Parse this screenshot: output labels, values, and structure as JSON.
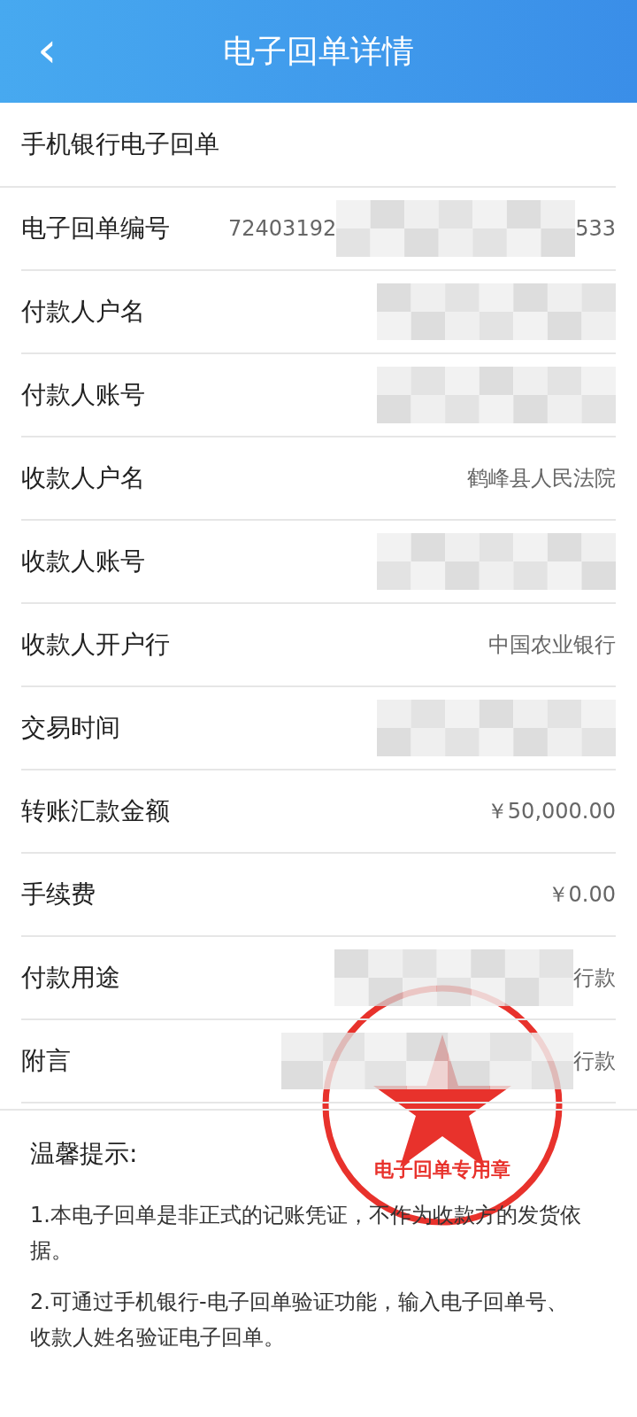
{
  "header": {
    "back_icon": "‹",
    "title": "电子回单详情"
  },
  "section_title": "手机银行电子回单",
  "rows": [
    {
      "label": "电子回单编号",
      "parts": [
        {
          "kind": "text",
          "text": "72403192"
        },
        {
          "kind": "redacted"
        },
        {
          "kind": "text",
          "text": "533"
        }
      ]
    },
    {
      "label": "付款人户名",
      "parts": [
        {
          "kind": "redacted"
        }
      ]
    },
    {
      "label": "付款人账号",
      "parts": [
        {
          "kind": "redacted"
        }
      ]
    },
    {
      "label": "收款人户名",
      "parts": [
        {
          "kind": "text",
          "text": "鹤峰县人民法院"
        }
      ]
    },
    {
      "label": "收款人账号",
      "parts": [
        {
          "kind": "redacted"
        }
      ]
    },
    {
      "label": "收款人开户行",
      "parts": [
        {
          "kind": "text",
          "text": "中国农业银行"
        }
      ]
    },
    {
      "label": "交易时间",
      "parts": [
        {
          "kind": "redacted"
        }
      ]
    },
    {
      "label": "转账汇款金额",
      "parts": [
        {
          "kind": "text",
          "text": "￥50,000.00"
        }
      ]
    },
    {
      "label": "手续费",
      "parts": [
        {
          "kind": "text",
          "text": "￥0.00"
        }
      ]
    },
    {
      "label": "付款用途",
      "parts": [
        {
          "kind": "redacted"
        },
        {
          "kind": "text",
          "text": "行款"
        }
      ]
    },
    {
      "label": "附言",
      "parts": [
        {
          "kind": "redacted"
        },
        {
          "kind": "text",
          "text": "行款"
        }
      ]
    }
  ],
  "stamp": {
    "text": "电子回单专用章"
  },
  "tips": {
    "title": "温馨提示:",
    "items": [
      "1.本电子回单是非正式的记账凭证，不作为收款方的发货依据。",
      "2.可通过手机银行-电子回单验证功能，输入电子回单号、收款人姓名验证电子回单。"
    ]
  }
}
